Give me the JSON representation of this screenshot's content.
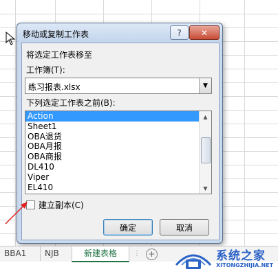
{
  "dialog": {
    "title": "移动或复制工作表",
    "help_label": "?",
    "close_label": "✕",
    "move_to_label": "将选定工作表移至",
    "workbook_label": "工作簿(T):",
    "workbook_value": "练习报表.xlsx",
    "before_sheet_label": "下列选定工作表之前(B):",
    "sheet_list": [
      "Action",
      "Sheet1",
      "OBA退货",
      "OBA月报",
      "OBA商报",
      "DL410",
      "Viper",
      "EL410"
    ],
    "selected_sheet": "Action",
    "create_copy_label": "建立副本(C)",
    "create_copy_checked": false,
    "ok_label": "确定",
    "cancel_label": "取消"
  },
  "sheet_tabs": {
    "tabs": [
      "BBA1",
      "NJB",
      "新建表格"
    ],
    "active_tab": "新建表格",
    "add_label": "+"
  },
  "watermark": {
    "name": "系统之家",
    "url": "XITONGZHIJIA.NET"
  },
  "colors": {
    "selection": "#3399ff",
    "active_tab_text": "#217346",
    "annotation_arrow": "#e02020",
    "watermark": "#2a62c8"
  }
}
